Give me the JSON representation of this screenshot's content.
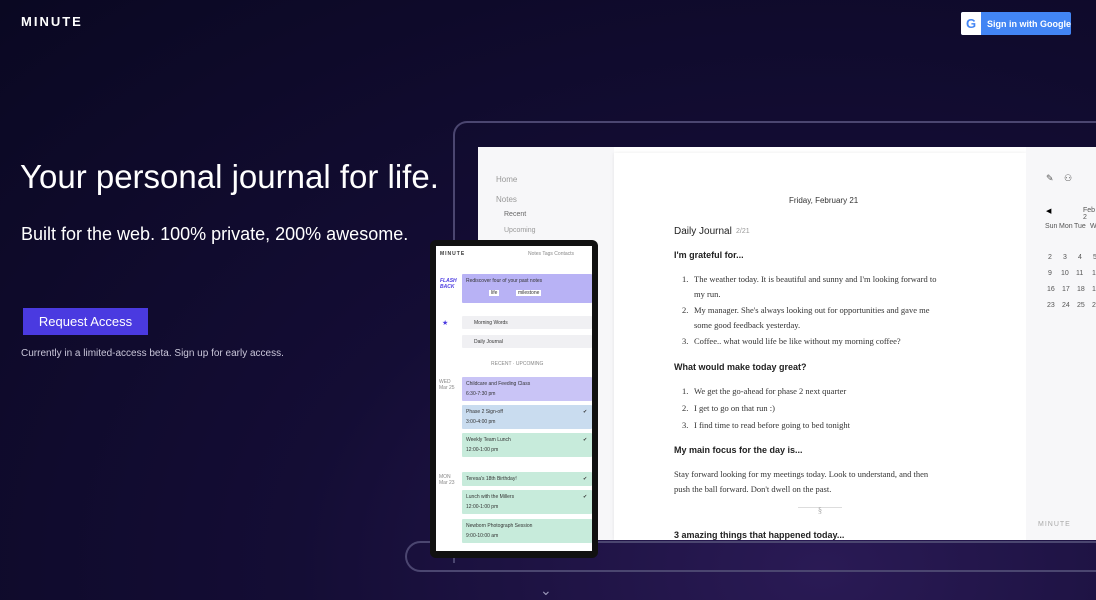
{
  "brand": "MINUTE",
  "signin": "Sign in with Google",
  "hero": {
    "title": "Your personal journal for life.",
    "subtitle": "Built for the web. 100% private, 200% awesome.",
    "cta": "Request Access",
    "note": "Currently in a limited-access beta. Sign up for early access."
  },
  "app": {
    "sidebar": [
      "Home",
      "Notes",
      "Recent",
      "Upcoming"
    ],
    "date": "Friday, February 21",
    "doc_title": "Daily Journal",
    "doc_date": "2/21",
    "q1": "I'm grateful for...",
    "l1": [
      "The weather today. It is beautiful and sunny and I'm looking forward to",
      "my run.",
      "My manager. She's always looking out for opportunities and gave me",
      "some good feedback yesterday.",
      "Coffee.. what would life be like without my morning coffee?"
    ],
    "q2": "What would make today great?",
    "l2": [
      "We get the go-ahead for phase 2 next quarter",
      "I get to go on that run :)",
      "I find time to read before going to bed tonight"
    ],
    "q3": "My main focus for the day is...",
    "p3a": "Stay forward looking for my meetings today. Look to understand, and then",
    "p3b": "push the ball forward. Don't dwell on the past.",
    "sep": "§",
    "q4": "3 amazing things that happened today...",
    "cal": {
      "nav": "◀",
      "month": "Feb 2",
      "days": [
        "Sun",
        "Mon",
        "Tue",
        "W"
      ],
      "rows": [
        [
          "2",
          "3",
          "4",
          "5"
        ],
        [
          "9",
          "10",
          "11",
          "1"
        ],
        [
          "16",
          "17",
          "18",
          "1"
        ],
        [
          "23",
          "24",
          "25",
          "2"
        ]
      ]
    },
    "footer": "MINUTE"
  },
  "tablet": {
    "brand": "MINUTE",
    "nav": "Notes  Tags  Contacts",
    "flash": "FLASH BACK",
    "rediscover": "Rediscover four of your past notes",
    "tags": [
      "life",
      "milestone"
    ],
    "morning": "Morning Words",
    "daily": "Daily Journal",
    "tabs": "RECENT · UPCOMING",
    "d1": "WED\nMar 25",
    "d2": "MON\nMar 23",
    "events": [
      {
        "t": "Childcare and Feeding Class",
        "s": "6:30-7:30 pm",
        "c": "#c9c4f6"
      },
      {
        "t": "Phase 2 Sign-off",
        "s": "3:00-4:00 pm",
        "c": "#c9dcef"
      },
      {
        "t": "Weekly Team Lunch",
        "s": "12:00-1:00 pm",
        "c": "#c7ebdb"
      },
      {
        "t": "Teresa's 18th Birthday!",
        "s": "",
        "c": "#c7ebdb"
      },
      {
        "t": "Lunch with the Millers",
        "s": "12:00-1:00 pm",
        "c": "#c7ebdb"
      },
      {
        "t": "Newborn Photograph Session",
        "s": "9:00-10:00 am",
        "c": "#c7ebdb"
      }
    ]
  }
}
